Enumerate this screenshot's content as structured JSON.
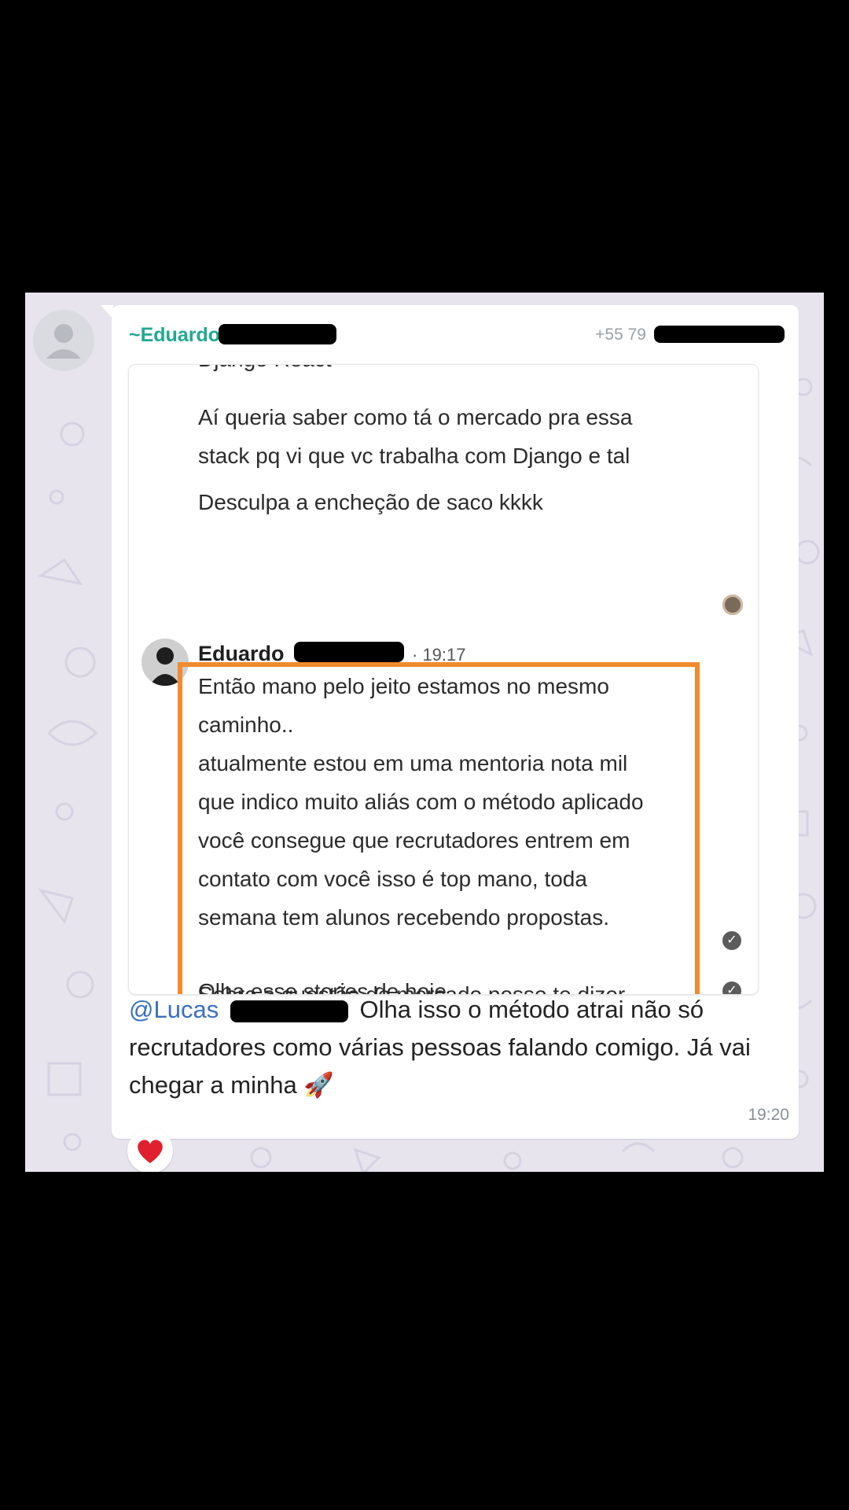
{
  "sender": {
    "name": "~Eduardo",
    "phone": "+55 79"
  },
  "quoted": {
    "cut_line": "Django React",
    "lines_before": [
      "Aí queria saber como tá o mercado pra essa",
      "stack pq vi que vc trabalha com Django e tal"
    ],
    "apology": "Desculpa a encheção de saco kkkk",
    "reply_author": "Eduardo",
    "reply_time": "· 19:17",
    "highlighted_text": "Então mano pelo jeito estamos no mesmo\ncaminho..\natualmente estou em uma mentoria nota mil\nque indico muito aliás com o método aplicado\nvocê consegue que recrutadores entrem em\ncontato com você isso é top mano, toda\nsemana tem alunos recebendo propostas.\n\nSobre a questão de mercado posso te dizer\nque é top e inclusive está carente de Dev",
    "bottom_cut": "Olha esse stories de hoje"
  },
  "message": {
    "mention": "@Lucas",
    "text": "Olha isso o método atrai não só recrutadores como várias pessoas falando comigo. Já vai chegar a minha",
    "emoji": "🚀",
    "time": "19:20"
  },
  "reaction": {
    "emoji": "❤️"
  },
  "colors": {
    "sender": "#1fa891",
    "mention": "#3a6fbf",
    "highlight_border": "#f28a2e",
    "chat_background": "#e7e4ee"
  }
}
